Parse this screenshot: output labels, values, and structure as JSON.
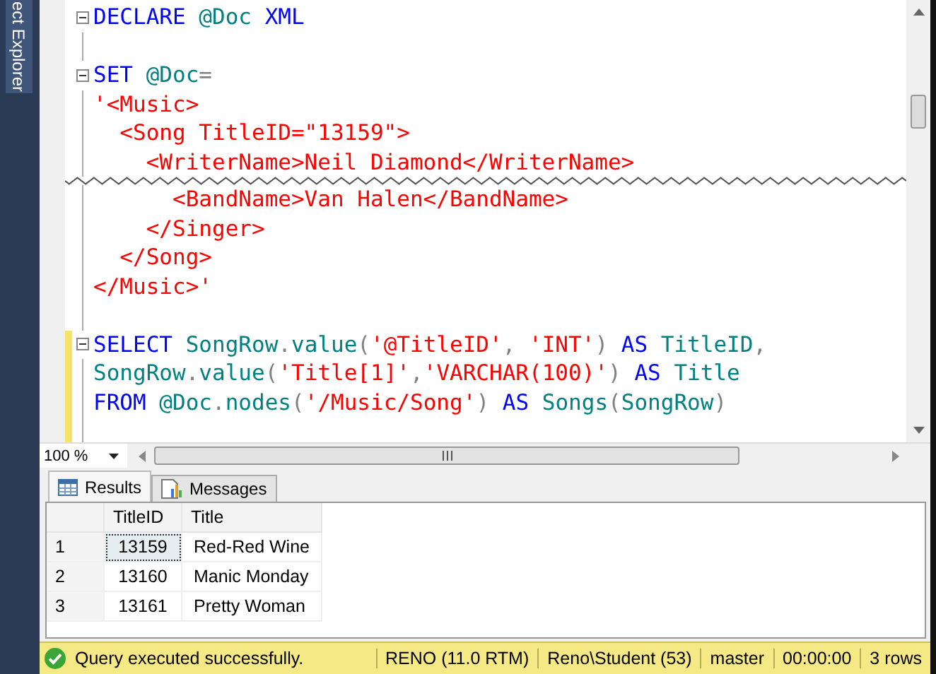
{
  "side_panel": {
    "label": "ect Explorer"
  },
  "editor": {
    "segments": [
      {
        "lines": [
          {
            "fold": true,
            "changed": false,
            "tokens": [
              {
                "text": "DECLARE",
                "kind": "keyword"
              },
              {
                "text": " @Doc",
                "kind": "identifier"
              },
              {
                "text": " XML",
                "kind": "keyword"
              }
            ]
          },
          {
            "fold": false,
            "changed": false
          },
          {
            "fold": true,
            "changed": false,
            "tokens": [
              {
                "text": "SET",
                "kind": "keyword"
              },
              {
                "text": " @Doc",
                "kind": "identifier"
              },
              {
                "text": "=",
                "kind": "operator"
              }
            ]
          },
          {
            "fold": false,
            "changed": false,
            "tokens": [
              {
                "text": "'<Music>",
                "kind": "string"
              }
            ]
          },
          {
            "fold": false,
            "changed": false,
            "tokens": [
              {
                "text": "  <Song TitleID=\"13159\">",
                "kind": "string"
              }
            ]
          },
          {
            "fold": false,
            "changed": false,
            "tokens": [
              {
                "text": "    <WriterName>Neil Diamond</WriterName>",
                "kind": "string"
              }
            ]
          }
        ]
      },
      {
        "lines": [
          {
            "fold": false,
            "changed": false,
            "tokens": [
              {
                "text": "      <BandName>Van Halen</BandName>",
                "kind": "string"
              }
            ]
          },
          {
            "fold": false,
            "changed": false,
            "tokens": [
              {
                "text": "    </Singer>",
                "kind": "string"
              }
            ]
          },
          {
            "fold": false,
            "changed": false,
            "tokens": [
              {
                "text": "  </Song>",
                "kind": "string"
              }
            ]
          },
          {
            "fold": false,
            "changed": false,
            "tokens": [
              {
                "text": "</Music>'",
                "kind": "string"
              }
            ]
          },
          {
            "fold": false,
            "changed": false
          },
          {
            "fold": true,
            "changed": true,
            "tokens": [
              {
                "text": "SELECT",
                "kind": "keyword"
              },
              {
                "text": " SongRow",
                "kind": "identifier"
              },
              {
                "text": ".",
                "kind": "operator"
              },
              {
                "text": "value",
                "kind": "identifier"
              },
              {
                "text": "(",
                "kind": "operator"
              },
              {
                "text": "'@TitleID'",
                "kind": "string"
              },
              {
                "text": ", ",
                "kind": "operator"
              },
              {
                "text": "'INT'",
                "kind": "string"
              },
              {
                "text": ")",
                "kind": "operator"
              },
              {
                "text": " AS",
                "kind": "keyword"
              },
              {
                "text": " TitleID",
                "kind": "identifier"
              },
              {
                "text": ",",
                "kind": "operator"
              }
            ]
          },
          {
            "fold": false,
            "changed": true,
            "tokens": [
              {
                "text": "SongRow",
                "kind": "identifier"
              },
              {
                "text": ".",
                "kind": "operator"
              },
              {
                "text": "value",
                "kind": "identifier"
              },
              {
                "text": "(",
                "kind": "operator"
              },
              {
                "text": "'Title[1]'",
                "kind": "string"
              },
              {
                "text": ",",
                "kind": "operator"
              },
              {
                "text": "'VARCHAR(100)'",
                "kind": "string"
              },
              {
                "text": ")",
                "kind": "operator"
              },
              {
                "text": " AS",
                "kind": "keyword"
              },
              {
                "text": " Title",
                "kind": "identifier"
              }
            ]
          },
          {
            "fold": false,
            "changed": true,
            "tokens": [
              {
                "text": "FROM",
                "kind": "keyword"
              },
              {
                "text": " @Doc",
                "kind": "identifier"
              },
              {
                "text": ".",
                "kind": "operator"
              },
              {
                "text": "nodes",
                "kind": "identifier"
              },
              {
                "text": "(",
                "kind": "operator"
              },
              {
                "text": "'/Music/Song'",
                "kind": "string"
              },
              {
                "text": ")",
                "kind": "operator"
              },
              {
                "text": " AS",
                "kind": "keyword"
              },
              {
                "text": " Songs",
                "kind": "identifier"
              },
              {
                "text": "(",
                "kind": "operator"
              },
              {
                "text": "SongRow",
                "kind": "identifier"
              },
              {
                "text": ")",
                "kind": "operator"
              }
            ]
          },
          {
            "fold": false,
            "changed": true
          }
        ]
      }
    ]
  },
  "zoom": {
    "value": "100 %"
  },
  "results": {
    "tabs": [
      {
        "label": "Results",
        "selected": true,
        "kind": "grid"
      },
      {
        "label": "Messages",
        "selected": false,
        "kind": "messages"
      }
    ],
    "columns": [
      "TitleID",
      "Title"
    ],
    "rows": [
      {
        "number": "1",
        "cells": [
          {
            "text": "13159",
            "selected": true
          },
          {
            "text": "Red-Red Wine",
            "selected": false
          }
        ]
      },
      {
        "number": "2",
        "cells": [
          {
            "text": "13160",
            "selected": false
          },
          {
            "text": "Manic Monday",
            "selected": false
          }
        ]
      },
      {
        "number": "3",
        "cells": [
          {
            "text": "13161",
            "selected": false
          },
          {
            "text": "Pretty Woman",
            "selected": false
          }
        ]
      }
    ]
  },
  "status_bar": {
    "message": "Query executed successfully.",
    "fields": [
      "RENO (11.0 RTM)",
      "Reno\\Student (53)",
      "master",
      "00:00:00",
      "3 rows"
    ]
  }
}
